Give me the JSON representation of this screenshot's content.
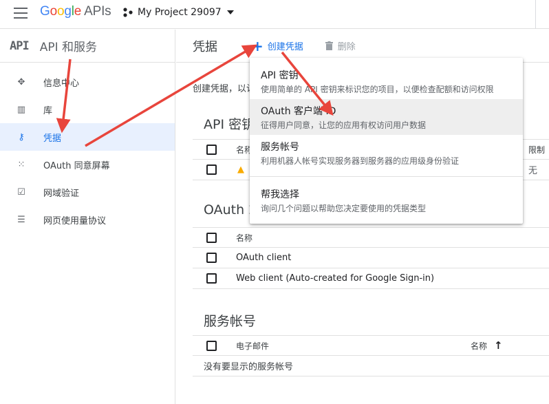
{
  "topbar": {
    "logo_google": [
      "G",
      "o",
      "o",
      "g",
      "l",
      "e"
    ],
    "logo_apis": "APIs",
    "project_name": "My Project 29097"
  },
  "sidebar": {
    "logo_text": "API",
    "title": "API 和服务",
    "items": [
      {
        "label": "信息中心",
        "icon": "dashboard-icon"
      },
      {
        "label": "库",
        "icon": "library-icon"
      },
      {
        "label": "凭据",
        "icon": "key-icon"
      },
      {
        "label": "OAuth 同意屏幕",
        "icon": "consent-icon"
      },
      {
        "label": "网域验证",
        "icon": "checkbox-icon"
      },
      {
        "label": "网页使用量协议",
        "icon": "settings-list-icon"
      }
    ]
  },
  "header": {
    "title": "凭据",
    "create_label": "创建凭据",
    "delete_label": "删除"
  },
  "intro": "创建凭据，以访",
  "api_keys": {
    "title": "API 密钥",
    "col_name": "名称",
    "col_limit": "限制",
    "row_limit": "无"
  },
  "oauth": {
    "title": "OAuth 2",
    "col_name": "名称",
    "rows": [
      "OAuth client",
      "Web client (Auto-created for Google Sign-in)"
    ]
  },
  "service_accounts": {
    "title": "服务帐号",
    "col_email": "电子邮件",
    "col_name": "名称",
    "empty": "没有要显示的服务帐号"
  },
  "dropdown": {
    "items": [
      {
        "title": "API 密钥",
        "desc": "使用简单的 API 密钥来标识您的项目，以便检查配额和访问权限"
      },
      {
        "title": "OAuth 客户端 ID",
        "desc": "征得用户同意，让您的应用有权访问用户数据"
      },
      {
        "title": "服务帐号",
        "desc": "利用机器人帐号实现服务器到服务器的应用级身份验证"
      },
      {
        "title": "帮我选择",
        "desc": "询问几个问题以帮助您决定要使用的凭据类型"
      }
    ]
  },
  "colors": {
    "accent": "#1a73e8",
    "annotation": "#e8453c",
    "active_bg": "#e8f0fe"
  }
}
